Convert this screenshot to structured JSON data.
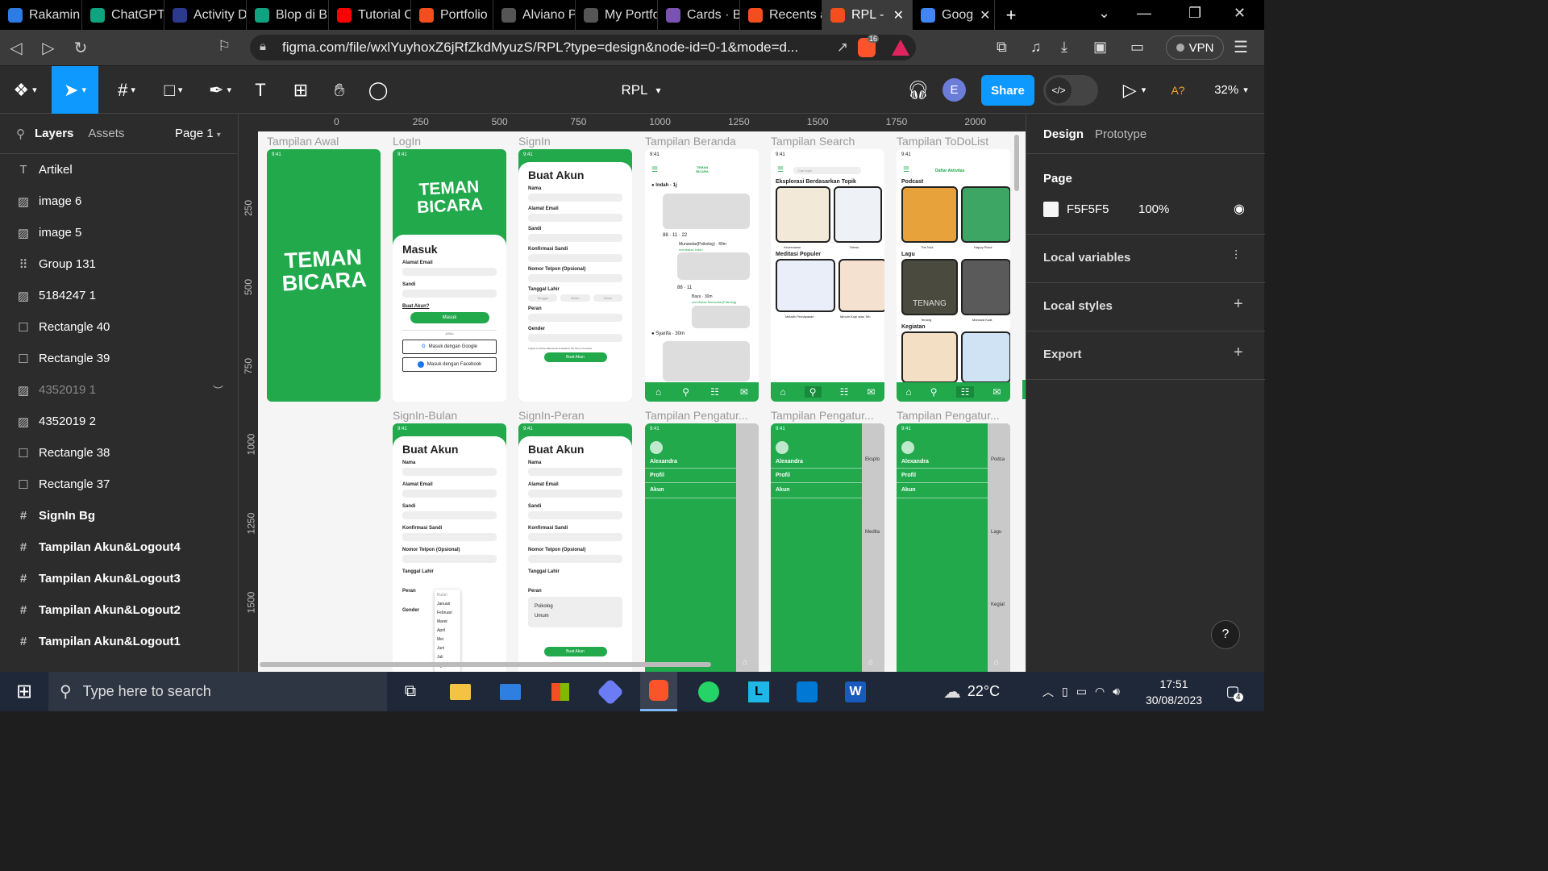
{
  "browser": {
    "tabs": [
      {
        "title": "Rakamin",
        "color": "#2d7be5"
      },
      {
        "title": "ChatGPT",
        "color": "#10a37f"
      },
      {
        "title": "Activity D",
        "color": "#2b3a8f"
      },
      {
        "title": "Blop di B",
        "color": "#10a37f"
      },
      {
        "title": "Tutorial C",
        "color": "#ff0000"
      },
      {
        "title": "Portfolio",
        "color": "#f24e1e"
      },
      {
        "title": "Alviano P",
        "color": "#555555"
      },
      {
        "title": "My Portfo",
        "color": "#555555"
      },
      {
        "title": "Cards · B",
        "color": "#7952b3"
      },
      {
        "title": "Recents a",
        "color": "#f24e1e"
      },
      {
        "title": "RPL -",
        "color": "#f24e1e"
      },
      {
        "title": "Goog",
        "color": "#4285f4"
      }
    ],
    "url": "figma.com/file/wxlYuyhoxZ6jRfZkdMyuzS/RPL?type=design&node-id=0-1&mode=d...",
    "brave_badge": "16",
    "vpn_label": "VPN"
  },
  "figma": {
    "file_name": "RPL",
    "avatar_initial": "E",
    "share_label": "Share",
    "a_label": "A?",
    "zoom": "32%",
    "left_tabs": {
      "layers": "Layers",
      "assets": "Assets",
      "page": "Page 1"
    },
    "layers": [
      {
        "name": "Artikel",
        "icon": "T",
        "type": "text"
      },
      {
        "name": "image 6",
        "icon": "▨",
        "type": "image"
      },
      {
        "name": "image 5",
        "icon": "▨",
        "type": "image"
      },
      {
        "name": "Group 131",
        "icon": "⠿",
        "type": "group"
      },
      {
        "name": "5184247 1",
        "icon": "▨",
        "type": "image"
      },
      {
        "name": "Rectangle 40",
        "icon": "☐",
        "type": "rect"
      },
      {
        "name": "Rectangle 39",
        "icon": "☐",
        "type": "rect"
      },
      {
        "name": "4352019 1",
        "icon": "▨",
        "type": "image-hidden"
      },
      {
        "name": "4352019 2",
        "icon": "▨",
        "type": "image"
      },
      {
        "name": "Rectangle 38",
        "icon": "☐",
        "type": "rect"
      },
      {
        "name": "Rectangle 37",
        "icon": "☐",
        "type": "rect"
      },
      {
        "name": "SignIn Bg",
        "icon": "#",
        "type": "frame"
      },
      {
        "name": "Tampilan Akun&Logout4",
        "icon": "#",
        "type": "frame"
      },
      {
        "name": "Tampilan Akun&Logout3",
        "icon": "#",
        "type": "frame"
      },
      {
        "name": "Tampilan Akun&Logout2",
        "icon": "#",
        "type": "frame"
      },
      {
        "name": "Tampilan Akun&Logout1",
        "icon": "#",
        "type": "frame"
      }
    ],
    "right_tabs": {
      "design": "Design",
      "prototype": "Prototype"
    },
    "page_section": {
      "title": "Page",
      "color_hex": "F5F5F5",
      "opacity": "100%"
    },
    "sections": [
      "Local variables",
      "Local styles",
      "Export"
    ],
    "help": "?"
  },
  "ruler": {
    "top": [
      "0",
      "250",
      "500",
      "750",
      "1000",
      "1250",
      "1500",
      "1750",
      "2000"
    ],
    "left": [
      "250",
      "500",
      "750",
      "1000",
      "1250",
      "1500"
    ]
  },
  "frames": {
    "awal": {
      "label": "Tampilan Awal",
      "time": "9:41",
      "logo1": "TEMAN",
      "logo2": "BICARA"
    },
    "login": {
      "label": "LogIn",
      "time": "9:41",
      "logo1": "TEMAN",
      "logo2": "BICARA",
      "heading": "Masuk",
      "email": "Alamat Email",
      "pass": "Sandi",
      "link": "Buat Akun?",
      "button": "Masuk",
      "atau": "ATAU",
      "google": "Masuk dengan Google",
      "facebook": "Masuk dengan Facebook"
    },
    "signin": {
      "label": "SignIn",
      "time": "9:41",
      "heading": "Buat Akun",
      "fields": [
        "Nama",
        "Alamat Email",
        "Sandi",
        "Konfirmasi Sandi",
        "Nomor Telpon (Opsional)",
        "Tanggal Lahir",
        "Peran",
        "Gender"
      ],
      "date": [
        "Tanggal",
        "Bulan",
        "Tahun"
      ],
      "agree": "I agree to all the statements included in the terms of service",
      "button": "Buat Akun"
    },
    "beranda": {
      "label": "Tampilan Beranda",
      "time": "9:41",
      "logo": "TEMAN BICARA",
      "user1": "Indah · 1j",
      "stats1": "88 · 11 · 22",
      "user2": "Munandar(Psikolog) · 40m",
      "reply": "membalas Indah",
      "stats2": "88 · 11",
      "user3": "Bayu · 30m",
      "reply2": "membalas Munandar(Psikolog)",
      "user4": "Syarifa · 30m"
    },
    "search": {
      "label": "Tampilan Search",
      "time": "9:41",
      "placeholder": "Cari topik",
      "title1": "Eksplorasi Berdasarkan Topik",
      "t1": "Kecemasan",
      "t2": "Stress",
      "title2": "Meditasi Populer",
      "m1": "Melatih Pernapasan",
      "m2": "Minum Kopi atau Teh"
    },
    "todo": {
      "label": "Tampilan ToDoList",
      "time": "9:41",
      "header": "Daftar Aktivitas",
      "podcast": "Podcast",
      "p1": "The Nod",
      "p2": "Happy Place",
      "lagu": "Lagu",
      "l1": "Tenang",
      "l2": "Manusia Kuat",
      "kegiatan": "Kegiatan",
      "tenang_text": "TENANG"
    },
    "bulan": {
      "label": "SignIn-Bulan",
      "time": "9:41",
      "heading": "Buat Akun",
      "months": [
        "Bulan",
        "Januari",
        "Februari",
        "Maret",
        "April",
        "Mei",
        "Juni",
        "Juli",
        "Agustus"
      ]
    },
    "peran": {
      "label": "SignIn-Peran",
      "time": "9:41",
      "heading": "Buat Akun",
      "options": [
        "Psikolog",
        "Umum"
      ],
      "button": "Buat Akun"
    },
    "pengatur1": {
      "label": "Tampilan Pengatur...",
      "time": "9:41",
      "name": "Alexandra",
      "profil": "Profil",
      "akun": "Akun"
    },
    "pengatur2": {
      "label": "Tampilan Pengatur...",
      "time": "9:41",
      "name": "Alexandra",
      "profil": "Profil",
      "akun": "Akun",
      "peek1": "Eksplo",
      "peek2": "Medita"
    },
    "pengatur3": {
      "label": "Tampilan Pengatur...",
      "time": "9:41",
      "name": "Alexandra",
      "profil": "Profil",
      "akun": "Akun",
      "peek1": "Podca",
      "peek2": "Lagu",
      "peek3": "Kegiat"
    }
  },
  "taskbar": {
    "search_placeholder": "Type here to search",
    "temp": "22°C",
    "time": "17:51",
    "date": "30/08/2023",
    "notif": "4"
  }
}
